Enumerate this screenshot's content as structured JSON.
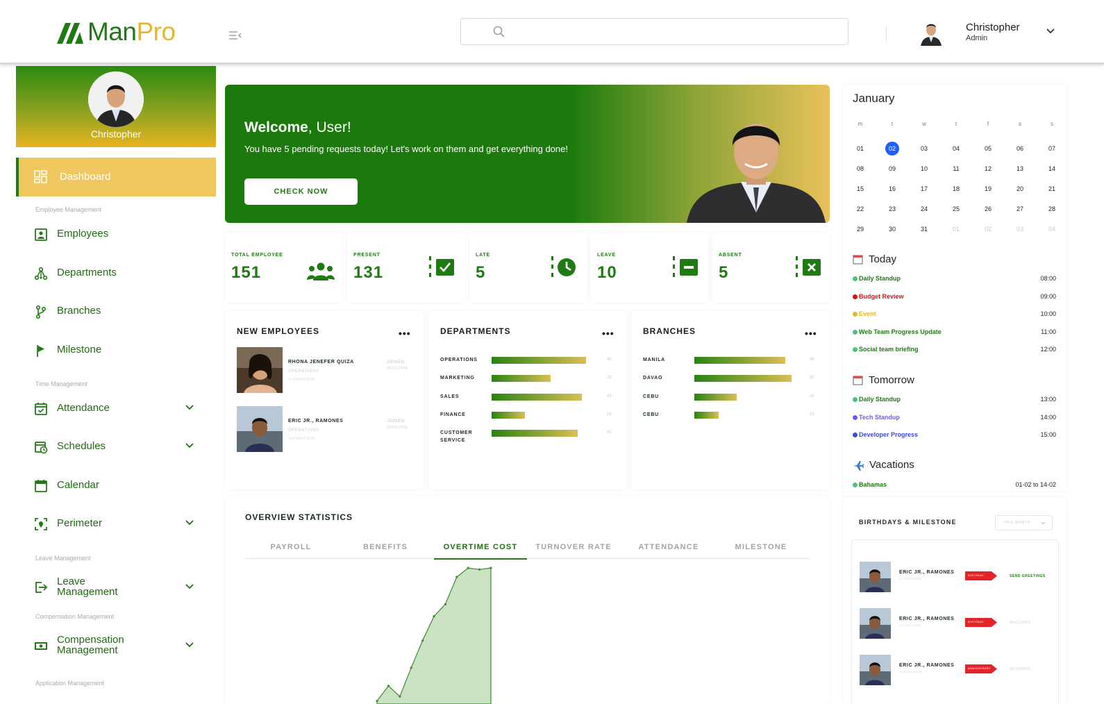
{
  "brand": {
    "part1": "Man",
    "part2": "Pro",
    "green": "#1f7a13",
    "gold": "#e5b62c"
  },
  "header": {
    "search_placeholder": "",
    "user_name": "Christopher",
    "user_role": "Admin"
  },
  "sidebar": {
    "profile_name": "Christopher",
    "active": {
      "label": "Dashboard"
    },
    "sections": {
      "employee": "Employee Management",
      "time": "Time Management",
      "leave": "Leave Management",
      "comp": "Compensation Management",
      "app": "Application Management"
    },
    "items": {
      "employees": "Employees",
      "departments": "Departments",
      "branches": "Branches",
      "milestone": "Milestone",
      "attendance": "Attendance",
      "schedules": "Schedules",
      "calendar": "Calendar",
      "perimeter": "Perimeter",
      "leave1": "Leave",
      "leave2": "Management",
      "comp1": "Compensation",
      "comp2": "Management"
    }
  },
  "welcome": {
    "greeting_bold": "Welcome",
    "greeting_rest": ", User!",
    "subtitle": "You have 5 pending requests today! Let's work on them and get everything done!",
    "button": "CHECK NOW"
  },
  "stats": [
    {
      "label": "TOTAL EMPLOYEE",
      "value": "151",
      "icon": "users-icon"
    },
    {
      "label": "PRESENT",
      "value": "131",
      "icon": "checklist-check-icon"
    },
    {
      "label": "LATE",
      "value": "5",
      "icon": "clock-late-icon"
    },
    {
      "label": "LEAVE",
      "value": "10",
      "icon": "checklist-minus-icon"
    },
    {
      "label": "ABSENT",
      "value": "5",
      "icon": "checklist-x-icon"
    }
  ],
  "new_employees": {
    "title": "NEW EMPLOYEES",
    "more": "•••",
    "list": [
      {
        "name": "RHONA JENEFER QUIZA",
        "dept": "OPERATIONS",
        "role": "SUPERVISOR",
        "joined_label": "JOINED",
        "joined_date": "05/03/2006"
      },
      {
        "name": "ERIC JR., RAMONES",
        "dept": "OPERATIONS",
        "role": "SUPERVISOR",
        "joined_label": "JOINED",
        "joined_date": "05/03/2006"
      }
    ]
  },
  "departments": {
    "title": "DEPARTMENTS",
    "more": "•••",
    "rows": [
      {
        "label": "OPERATIONS",
        "value": 45
      },
      {
        "label": "MARKETING",
        "value": 28
      },
      {
        "label": "SALES",
        "value": 43
      },
      {
        "label": "FINANCE",
        "value": 16
      },
      {
        "label": "CUSTOMER SERVICE",
        "value": 41
      }
    ]
  },
  "branches": {
    "title": "BRANCHES",
    "more": "•••",
    "rows": [
      {
        "label": "MANILA",
        "value": 56
      },
      {
        "label": "DAVAO",
        "value": 60
      },
      {
        "label": "CEBU",
        "value": 26
      },
      {
        "label": "CEBU",
        "value": 15
      }
    ]
  },
  "overview": {
    "title": "OVERVIEW STATISTICS",
    "tabs": [
      "PAYROLL",
      "BENEFITS",
      "OVERTIME COST",
      "TURNOVER RATE",
      "ATTENDANCE",
      "MILESTONE"
    ],
    "active_tab": 2
  },
  "chart_data": {
    "type": "area",
    "title": "",
    "xlabel": "",
    "ylabel": "",
    "color": "#c8e2c2",
    "line_color": "#3f8a2e",
    "x": [
      0,
      1,
      2,
      3,
      4,
      5,
      6,
      7,
      8,
      9,
      10
    ],
    "values": [
      10,
      60,
      25,
      120,
      210,
      290,
      330,
      420,
      450,
      445,
      450
    ],
    "ylim": [
      0,
      480
    ]
  },
  "calendar": {
    "month": "January",
    "dow": [
      "m",
      "t",
      "w",
      "t",
      "f",
      "s",
      "s"
    ],
    "weeks": [
      [
        "01",
        "02",
        "03",
        "04",
        "05",
        "06",
        "07"
      ],
      [
        "08",
        "09",
        "10",
        "11",
        "12",
        "13",
        "14"
      ],
      [
        "15",
        "16",
        "17",
        "18",
        "19",
        "20",
        "21"
      ],
      [
        "22",
        "23",
        "24",
        "25",
        "26",
        "27",
        "28"
      ],
      [
        "29",
        "30",
        "31",
        "01",
        "02",
        "03",
        "04"
      ]
    ],
    "selected": "02"
  },
  "agenda": {
    "today_title": "Today",
    "today": [
      {
        "name": "Daily Standup",
        "time": "08:00",
        "color": "#4cc07a"
      },
      {
        "name": "Budget Review",
        "time": "09:00",
        "color": "#d11616"
      },
      {
        "name": "Event",
        "time": "10:00",
        "color": "#e5b62c"
      },
      {
        "name": "Web Team Progress Update",
        "time": "11:00",
        "color": "#4cc07a"
      },
      {
        "name": "Social team briefing",
        "time": "12:00",
        "color": "#4cc07a"
      }
    ],
    "tomorrow_title": "Tomorrow",
    "tomorrow": [
      {
        "name": "Daily Standup",
        "time": "13:00",
        "color": "#4cc07a"
      },
      {
        "name": "Tech Standup",
        "time": "14:00",
        "color": "#7b55f0"
      },
      {
        "name": "Developer Progress",
        "time": "15:00",
        "color": "#3b49d6"
      }
    ],
    "vacations_title": "Vacations",
    "vacations": [
      {
        "name": "Bahamas",
        "time": "01-02 to 14-02",
        "color": "#4cc07a"
      }
    ]
  },
  "birthdays": {
    "title": "BIRTHDAYS & MILESTONE",
    "filter": "THIS MONTH",
    "rows": [
      {
        "name": "ERIC JR., RAMONES",
        "role": "SUPERVISOR",
        "tag": "BIRTHDAY",
        "action": "SEND GREETINGS",
        "action_color": "#1f7a13"
      },
      {
        "name": "ERIC JR., RAMONES",
        "role": "SUPERVISOR",
        "tag": "BIRTHDAY",
        "action": "05/12/2002",
        "action_color": "#c8c8c8"
      },
      {
        "name": "ERIC JR., RAMONES",
        "role": "SUPERVISOR",
        "tag": "ANNIVERSARY",
        "action": "05/13/2002",
        "action_color": "#c8c8c8"
      }
    ]
  }
}
